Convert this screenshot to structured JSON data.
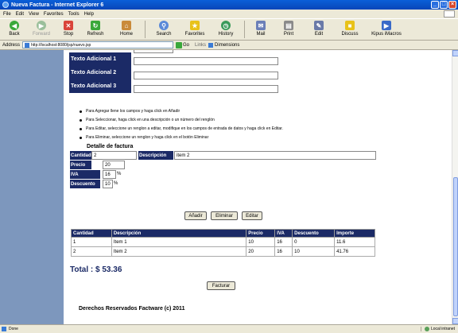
{
  "window": {
    "title": "Nueva Factura - Internet Explorer 6",
    "buttons": [
      "_",
      "□",
      "×"
    ]
  },
  "menu": [
    "File",
    "Edit",
    "View",
    "Favorites",
    "Tools",
    "Help"
  ],
  "toolbar": [
    {
      "label": "Back",
      "icon": "back-icon",
      "color": "#3aa83a"
    },
    {
      "label": "Forward",
      "icon": "forward-icon",
      "color": "#9bbf9b",
      "disabled": true
    },
    {
      "label": "Stop",
      "icon": "stop-icon",
      "color": "#d9443a"
    },
    {
      "label": "Refresh",
      "icon": "refresh-icon",
      "color": "#3aa83a"
    },
    {
      "label": "Home",
      "icon": "home-icon",
      "color": "#c98a3a"
    },
    {
      "label": "Search",
      "icon": "search-icon",
      "color": "#5a8ad8"
    },
    {
      "label": "Favorites",
      "icon": "favorites-icon",
      "color": "#e8c21a"
    },
    {
      "label": "History",
      "icon": "history-icon",
      "color": "#3a9a5a"
    },
    {
      "label": "Mail",
      "icon": "mail-icon",
      "color": "#6b7fb8"
    },
    {
      "label": "Print",
      "icon": "print-icon",
      "color": "#8a8a8a"
    },
    {
      "label": "Edit",
      "icon": "edit-icon",
      "color": "#6a7aa8"
    },
    {
      "label": "Discuss",
      "icon": "discuss-icon",
      "color": "#e8c21a"
    },
    {
      "label": "Kipus iMacros",
      "icon": "imacros-icon",
      "color": "#3a6ac8"
    }
  ],
  "address": {
    "label": "Address",
    "url": "http://localhost:8080/jsp/nuevo.jsp",
    "go": "Go",
    "links_label": "Links",
    "link": "Dimensions"
  },
  "extra_text": {
    "rows": [
      {
        "label": "Texto Adicional 1"
      },
      {
        "label": "Texto Adicional 2"
      },
      {
        "label": "Texto Adicional 3"
      }
    ]
  },
  "instructions": [
    "Para Agregar llene los campos y haga click en Añadir",
    "Para Seleccionar, haga click en una descripción o un número del renglón",
    "Para Editar, seleccione un renglon a editar, modifique en los campos de entrada de datos y haga click en Editar.",
    "Para Eliminar, seleccione un renglon y haga click en el botón Eliminar"
  ],
  "detail": {
    "title": "Detalle de factura",
    "cantidad_label": "Cantidad",
    "cantidad_value": "2",
    "descripcion_label": "Descripción",
    "descripcion_value": "item 2",
    "precio_label": "Precio",
    "precio_value": "20",
    "iva_label": "IVA",
    "iva_value": "16",
    "descuento_label": "Descuento",
    "descuento_value": "10",
    "pct": "%"
  },
  "buttons": {
    "add": "Añadir",
    "delete": "Eliminar",
    "edit": "Editar",
    "invoice": "Facturar"
  },
  "table": {
    "headers": [
      "Cantidad",
      "Descripción",
      "Precio",
      "IVA",
      "Descuento",
      "Importe"
    ],
    "rows": [
      [
        "1",
        "Item 1",
        "10",
        "16",
        "0",
        "11.6"
      ],
      [
        "2",
        "Item 2",
        "20",
        "16",
        "10",
        "41.76"
      ]
    ]
  },
  "total": "Total : $ 53.36",
  "footer": "Derechos Reservados Factware (c) 2011",
  "status": {
    "left": "Done",
    "zone": "Local intranet"
  },
  "colors": {
    "sidebar": "#7d97bd",
    "header_navy": "#1b2a66",
    "title_blue": "#0a5fd8"
  }
}
